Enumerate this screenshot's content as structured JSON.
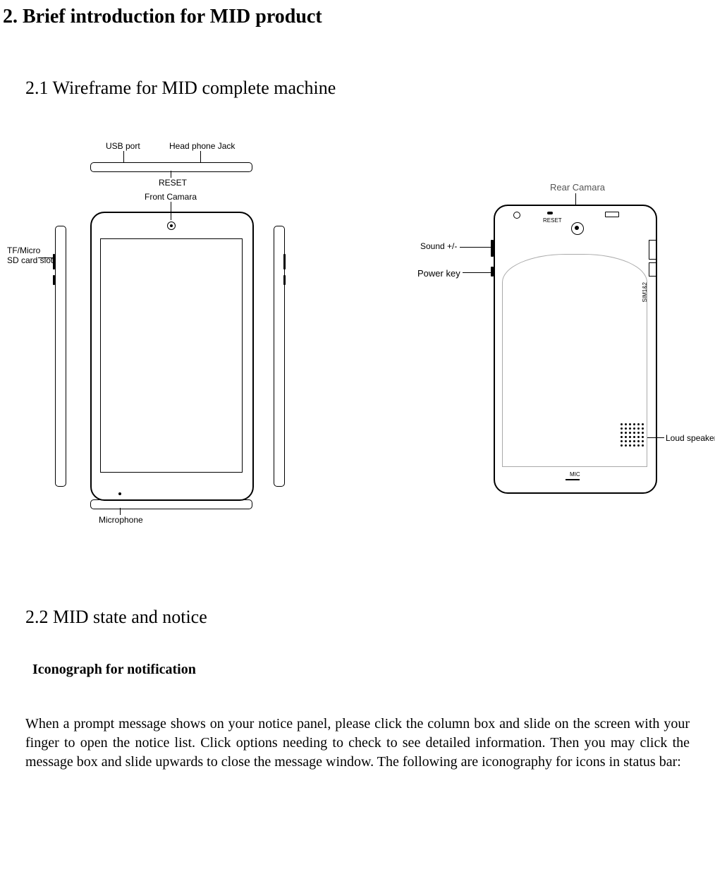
{
  "headings": {
    "main": "2. Brief introduction for MID product",
    "sub1": "2.1 Wireframe for MID complete machine",
    "sub2": "2.2 MID state and notice",
    "iconograph": "Iconograph for notification"
  },
  "paragraph": "When a prompt message shows on your notice panel, please click the column box and slide on the screen with your finger to open the notice list. Click options needing to check to see detailed information. Then you may click the message box and slide upwards to close the message window. The following are iconography for icons in status bar:",
  "labels": {
    "usb": "USB port",
    "headphone": "Head phone Jack",
    "reset": "RESET",
    "front_cam": "Front Camara",
    "sd": "TF/Micro\nSD card slot",
    "microphone": "Microphone",
    "rear_cam": "Rear Camara",
    "sound": "Sound +/-",
    "power": "Power key",
    "loud": "Loud speaker",
    "mic_back": "MIC",
    "sim": "SIM1&2"
  }
}
